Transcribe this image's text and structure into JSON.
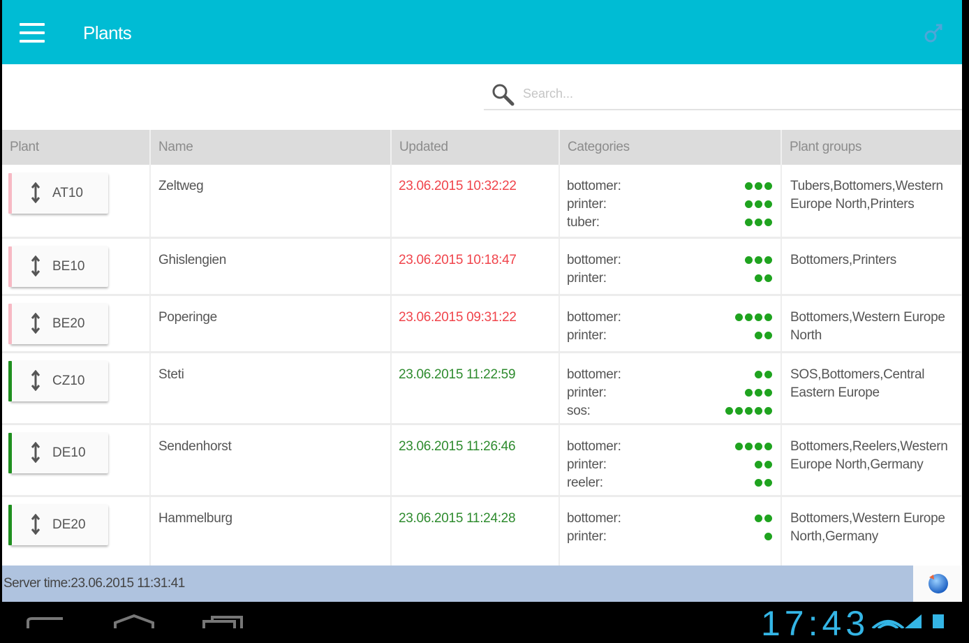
{
  "app": {
    "title": "Plants",
    "colors": {
      "appbar": "#00bcd4",
      "updated_stale": "#f0444b",
      "updated_fresh": "#2e8b2e",
      "status_dot": "#1fa31f",
      "bar_pink": "#f7b9c4",
      "bar_green": "#1f8f1f",
      "footer": "#afc3df"
    }
  },
  "search": {
    "placeholder": "Search..."
  },
  "table": {
    "headers": [
      "Plant",
      "Name",
      "Updated",
      "Categories",
      "Plant groups"
    ],
    "rows": [
      {
        "plant": "AT10",
        "status_bar": "pink",
        "name": "Zeltweg",
        "updated": "23.06.2015 10:32:22",
        "updated_state": "stale",
        "categories": [
          {
            "label": "bottomer:",
            "dots": 3
          },
          {
            "label": "printer:",
            "dots": 3
          },
          {
            "label": "tuber:",
            "dots": 3
          }
        ],
        "groups": "Tubers,Bottomers,Western Europe North,Printers"
      },
      {
        "plant": "BE10",
        "status_bar": "pink",
        "name": "Ghislengien",
        "updated": "23.06.2015 10:18:47",
        "updated_state": "stale",
        "categories": [
          {
            "label": "bottomer:",
            "dots": 3
          },
          {
            "label": "printer:",
            "dots": 2
          }
        ],
        "groups": "Bottomers,Printers"
      },
      {
        "plant": "BE20",
        "status_bar": "pink",
        "name": "Poperinge",
        "updated": "23.06.2015 09:31:22",
        "updated_state": "stale",
        "categories": [
          {
            "label": "bottomer:",
            "dots": 4
          },
          {
            "label": "printer:",
            "dots": 2
          }
        ],
        "groups": "Bottomers,Western Europe North"
      },
      {
        "plant": "CZ10",
        "status_bar": "green",
        "name": "Steti",
        "updated": "23.06.2015 11:22:59",
        "updated_state": "fresh",
        "categories": [
          {
            "label": "bottomer:",
            "dots": 2
          },
          {
            "label": "printer:",
            "dots": 3
          },
          {
            "label": "sos:",
            "dots": 5
          }
        ],
        "groups": "SOS,Bottomers,Central Eastern Europe"
      },
      {
        "plant": "DE10",
        "status_bar": "green",
        "name": "Sendenhorst",
        "updated": "23.06.2015 11:26:46",
        "updated_state": "fresh",
        "categories": [
          {
            "label": "bottomer:",
            "dots": 4
          },
          {
            "label": "printer:",
            "dots": 2
          },
          {
            "label": "reeler:",
            "dots": 2
          }
        ],
        "groups": "Bottomers,Reelers,Western Europe North,Germany"
      },
      {
        "plant": "DE20",
        "status_bar": "green",
        "name": "Hammelburg",
        "updated": "23.06.2015 11:24:28",
        "updated_state": "fresh",
        "categories": [
          {
            "label": "bottomer:",
            "dots": 2
          },
          {
            "label": "printer:",
            "dots": 1
          }
        ],
        "groups": "Bottomers,Western Europe North,Germany"
      }
    ]
  },
  "footer": {
    "server_time": "Server time:23.06.2015 11:31:41"
  },
  "statusbar": {
    "clock": "17:43"
  },
  "icons": {
    "menu": "hamburger-menu-icon",
    "settings": "gender-icon",
    "search": "magnifier-icon",
    "refresh": "refresh-globe-icon"
  }
}
